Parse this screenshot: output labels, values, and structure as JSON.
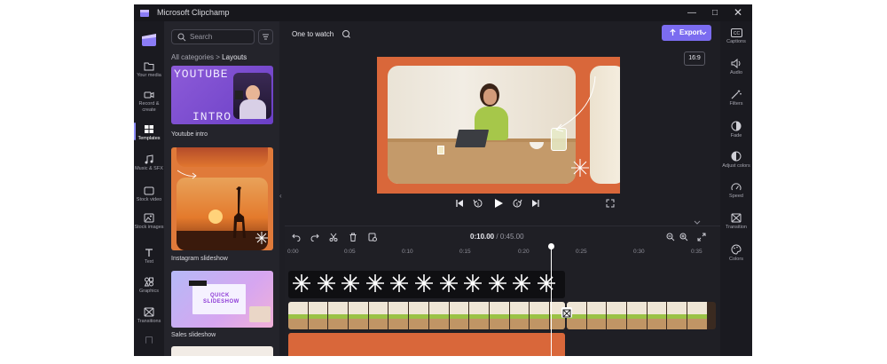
{
  "window": {
    "title": "Microsoft Clipchamp",
    "controls": [
      "minimize",
      "maximize",
      "close"
    ]
  },
  "left_nav": {
    "items": [
      {
        "label": "Your media",
        "icon": "folder-icon"
      },
      {
        "label": "Record & create",
        "icon": "video-camera-icon"
      },
      {
        "label": "Templates",
        "icon": "templates-icon",
        "active": true
      },
      {
        "label": "Music & SFX",
        "icon": "music-note-icon"
      },
      {
        "label": "Stock video",
        "icon": "film-icon"
      },
      {
        "label": "Stock images",
        "icon": "image-icon"
      },
      {
        "label": "Text",
        "icon": "text-icon"
      },
      {
        "label": "Graphics",
        "icon": "shapes-icon"
      },
      {
        "label": "Transitions",
        "icon": "transitions-icon"
      }
    ]
  },
  "templates_panel": {
    "search_placeholder": "Search",
    "breadcrumb": {
      "parent": "All categories",
      "separator": ">",
      "current": "Layouts"
    },
    "templates": [
      {
        "title": "Youtube intro",
        "thumb_text_top": "YOUTUBE",
        "thumb_text_bottom": "INTRO"
      },
      {
        "title": "Instagram slideshow"
      },
      {
        "title": "Sales slideshow",
        "thumb_text_1": "QUICK",
        "thumb_text_2": "SLIDESHOW"
      }
    ]
  },
  "editor": {
    "project_title": "One to watch",
    "export_label": "Export",
    "aspect_ratio": "16:9",
    "colors": {
      "accent": "#7b6cf0",
      "preview_bg": "#d9673a"
    }
  },
  "right_rail": {
    "items": [
      {
        "label": "Captions",
        "icon": "cc-icon"
      },
      {
        "label": "Audio",
        "icon": "speaker-icon"
      },
      {
        "label": "Filters",
        "icon": "magic-wand-icon"
      },
      {
        "label": "Fade",
        "icon": "fade-icon"
      },
      {
        "label": "Adjust colors",
        "icon": "contrast-icon"
      },
      {
        "label": "Speed",
        "icon": "speedometer-icon"
      },
      {
        "label": "Transition",
        "icon": "transition-icon"
      },
      {
        "label": "Colors",
        "icon": "palette-icon"
      }
    ]
  },
  "timeline": {
    "current_time": "0:10.00",
    "separator": "/",
    "total_time": "0:45.00",
    "ruler": [
      "0:00",
      "0:05",
      "0:10",
      "0:15",
      "0:20",
      "0:25",
      "0:30",
      "0:35"
    ]
  }
}
